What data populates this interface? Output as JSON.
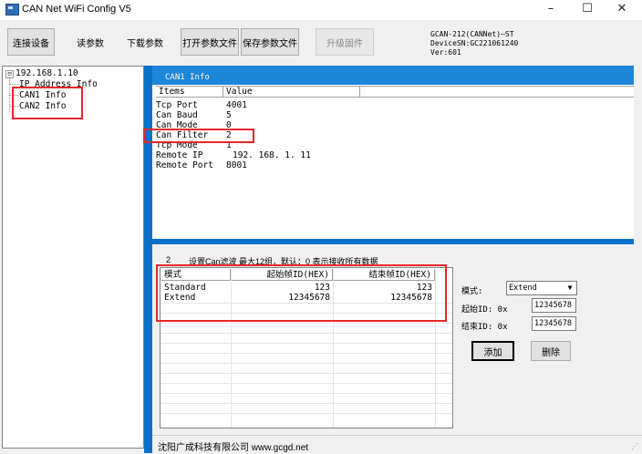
{
  "window": {
    "title": "CAN Net WiFi Config V5",
    "minimize": "–",
    "maximize": "☐",
    "close": "✕"
  },
  "toolbar": {
    "connect": "连接设备",
    "read_params": "读参数",
    "download_params": "下载参数",
    "open_param_file": "打开参数文件",
    "save_param_file": "保存参数文件",
    "upgrade_firmware": "升级固件"
  },
  "device_info": {
    "model": "GCAN-212(CANNet)—ST",
    "serial": "DeviceSN:GC221061240",
    "version": "Ver:601"
  },
  "tree": {
    "root": "192.168.1.10",
    "expander": "⊟",
    "items": [
      "IP Address Info",
      "CAN1 Info",
      "CAN2 Info"
    ]
  },
  "info_panel": {
    "title": "CAN1 Info",
    "columns": [
      "Items",
      "Value"
    ],
    "rows": [
      {
        "item": "Tcp Port",
        "value": "4001"
      },
      {
        "item": "Can Baud",
        "value": "5"
      },
      {
        "item": "Can Mode",
        "value": "0"
      },
      {
        "item": "Can Filter",
        "value": "2"
      },
      {
        "item": "Tcp Mode",
        "value": "1"
      },
      {
        "item": "Remote IP",
        "value": "192. 168. 1. 11"
      },
      {
        "item": "Remote Port",
        "value": "8001"
      }
    ]
  },
  "filter_panel": {
    "index": "2",
    "description": "设置Can滤波 最大12组，默认：0 表示接收所有数据",
    "columns": [
      "模式",
      "起始帧ID(HEX)",
      "结束帧ID(HEX)"
    ],
    "rows": [
      {
        "mode": "Standard",
        "start": "123",
        "end": "123"
      },
      {
        "mode": "Extend",
        "start": "12345678",
        "end": "12345678"
      }
    ],
    "form": {
      "mode_label": "模式:",
      "mode_value": "Extend",
      "start_label": "起始ID: 0x",
      "start_value": "12345678",
      "end_label": "结束ID:  0x",
      "end_value": "12345678",
      "add_button": "添加",
      "delete_button": "删除"
    }
  },
  "status": {
    "company": "沈阳广成科技有限公司   www.gcgd.net"
  }
}
